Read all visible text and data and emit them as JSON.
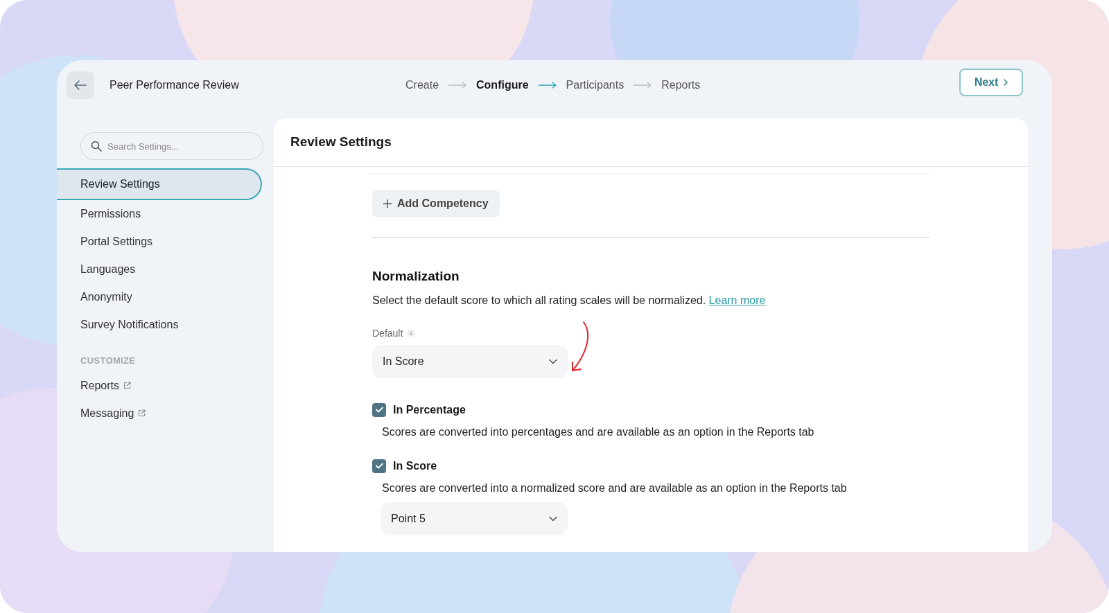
{
  "header": {
    "title": "Peer Performance Review",
    "steps": [
      {
        "label": "Create",
        "selected": false
      },
      {
        "label": "Configure",
        "selected": true
      },
      {
        "label": "Participants",
        "selected": false
      },
      {
        "label": "Reports",
        "selected": false
      }
    ],
    "next_button": "Next"
  },
  "sidebar": {
    "search": {
      "placeholder": "Search Settings..."
    },
    "items": [
      {
        "label": "Review Settings",
        "selected": true
      },
      {
        "label": "Permissions",
        "selected": false
      },
      {
        "label": "Portal Settings",
        "selected": false
      },
      {
        "label": "Languages",
        "selected": false
      },
      {
        "label": "Anonymity",
        "selected": false
      },
      {
        "label": "Survey Notifications",
        "selected": false
      }
    ],
    "section_heading": "CUSTOMIZE",
    "links": [
      "Reports",
      "Messaging"
    ]
  },
  "main": {
    "title": "Review Settings",
    "add_button": "Add Competency",
    "normalization": {
      "heading": "Normalization",
      "description": "Select the default score to which all rating scales will be normalized.",
      "link": "Learn more",
      "default_label": "Default",
      "default_value": "In Score",
      "options": [
        {
          "label": "In Percentage",
          "checked": true,
          "description": "Scores are converted into percentages and are available as an option in the Reports tab"
        },
        {
          "label": "In Score",
          "checked": true,
          "description": "Scores are converted into a normalized score and are available as an option in the Reports tab",
          "select_value": "Point 5"
        }
      ]
    }
  }
}
